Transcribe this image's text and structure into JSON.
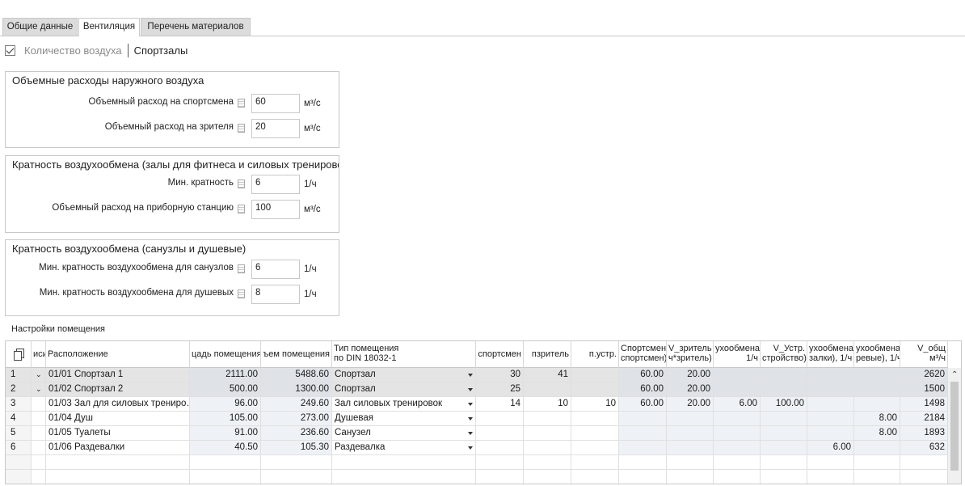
{
  "tabs": [
    {
      "label": "Общие данные"
    },
    {
      "label": "Вентиляция"
    },
    {
      "label": "Перечень материалов"
    }
  ],
  "breadcrumb": {
    "checked": true,
    "part1": "Количество воздуха",
    "part2": "Спортзалы"
  },
  "group1": {
    "title": "Объемные расходы наружного воздуха",
    "fields": [
      {
        "label": "Объемный расход на спортсмена",
        "value": "60",
        "unit": "м³/с"
      },
      {
        "label": "Объемный расход на зрителя",
        "value": "20",
        "unit": "м³/с"
      }
    ]
  },
  "group2": {
    "title": "Кратность воздухообмена (залы для фитнеса и силовых тренировок",
    "fields": [
      {
        "label": "Мин. кратность",
        "value": "6",
        "unit": "1/ч"
      },
      {
        "label": "Объемный расход на приборную станцию",
        "value": "100",
        "unit": "м³/с"
      }
    ]
  },
  "group3": {
    "title": "Кратность воздухообмена (санузлы и душевые)",
    "fields": [
      {
        "label": "Мин. кратность воздухообмена для санузлов",
        "value": "6",
        "unit": "1/ч"
      },
      {
        "label": "Мин. кратность воздухообмена для душевых",
        "value": "8",
        "unit": "1/ч"
      }
    ]
  },
  "section_label": "Настройки помещения",
  "grid": {
    "headers": [
      {
        "l1": "иси",
        "l2": ""
      },
      {
        "l1": "Расположение",
        "l2": ""
      },
      {
        "l1": "цадь помещения",
        "l2": ""
      },
      {
        "l1": "ъем помещения",
        "l2": ""
      },
      {
        "l1": "Тип помещения",
        "l2": "по DIN 18032-1"
      },
      {
        "l1": "спортсмен",
        "l2": ""
      },
      {
        "l1": "пзритель",
        "l2": ""
      },
      {
        "l1": "п.устр.",
        "l2": ""
      },
      {
        "l1": "Спортсмен",
        "l2": "спортсмен)"
      },
      {
        "l1": "V_зритель",
        "l2": "ч*зритель)"
      },
      {
        "l1": "ухообмена",
        "l2": "1/ч"
      },
      {
        "l1": "V_Устр.",
        "l2": "стройство)"
      },
      {
        "l1": "ухообмена",
        "l2": "залки), 1/ч"
      },
      {
        "l1": "ухообмена",
        "l2": "ревые), 1/ч"
      },
      {
        "l1": "V_общ",
        "l2": "м³/ч"
      }
    ],
    "rows": [
      {
        "num": "1",
        "exp": "⌄",
        "loc": "01/01 Спортзал 1",
        "area": "2111.00",
        "vol": "5488.60",
        "type": "Спортзал",
        "n_sp": "30",
        "n_z": "41",
        "n_u": "",
        "v_sp": "60.00",
        "v_z": "20.00",
        "k": "",
        "v_u": "",
        "k_r": "",
        "k_d": "",
        "v_tot": "2620"
      },
      {
        "num": "2",
        "exp": "⌄",
        "loc": "01/02 Спортзал 2",
        "area": "500.00",
        "vol": "1300.00",
        "type": "Спортзал",
        "n_sp": "25",
        "n_z": "",
        "n_u": "",
        "v_sp": "60.00",
        "v_z": "20.00",
        "k": "",
        "v_u": "",
        "k_r": "",
        "k_d": "",
        "v_tot": "1500"
      },
      {
        "num": "3",
        "exp": "",
        "loc": "01/03 Зал для силовых трениро…",
        "area": "96.00",
        "vol": "249.60",
        "type": "Зал силовых тренировок",
        "n_sp": "14",
        "n_z": "10",
        "n_u": "10",
        "v_sp": "60.00",
        "v_z": "20.00",
        "k": "6.00",
        "v_u": "100.00",
        "k_r": "",
        "k_d": "",
        "v_tot": "1498"
      },
      {
        "num": "4",
        "exp": "",
        "loc": "01/04 Душ",
        "area": "105.00",
        "vol": "273.00",
        "type": "Душевая",
        "n_sp": "",
        "n_z": "",
        "n_u": "",
        "v_sp": "",
        "v_z": "",
        "k": "",
        "v_u": "",
        "k_r": "",
        "k_d": "8.00",
        "v_tot": "2184"
      },
      {
        "num": "5",
        "exp": "",
        "loc": "01/05 Туалеты",
        "area": "91.00",
        "vol": "236.60",
        "type": "Санузел",
        "n_sp": "",
        "n_z": "",
        "n_u": "",
        "v_sp": "",
        "v_z": "",
        "k": "",
        "v_u": "",
        "k_r": "",
        "k_d": "8.00",
        "v_tot": "1893"
      },
      {
        "num": "6",
        "exp": "",
        "loc": "01/06 Раздевалки",
        "area": "40.50",
        "vol": "105.30",
        "type": "Раздевалка",
        "n_sp": "",
        "n_z": "",
        "n_u": "",
        "v_sp": "",
        "v_z": "",
        "k": "",
        "v_u": "",
        "k_r": "6.00",
        "k_d": "",
        "v_tot": "632"
      }
    ]
  },
  "icons": {
    "copy": "copy-icon",
    "calc": "calculator-icon",
    "dropdown": "chevron-down-icon",
    "scroll_up": "chevron-up-icon"
  }
}
